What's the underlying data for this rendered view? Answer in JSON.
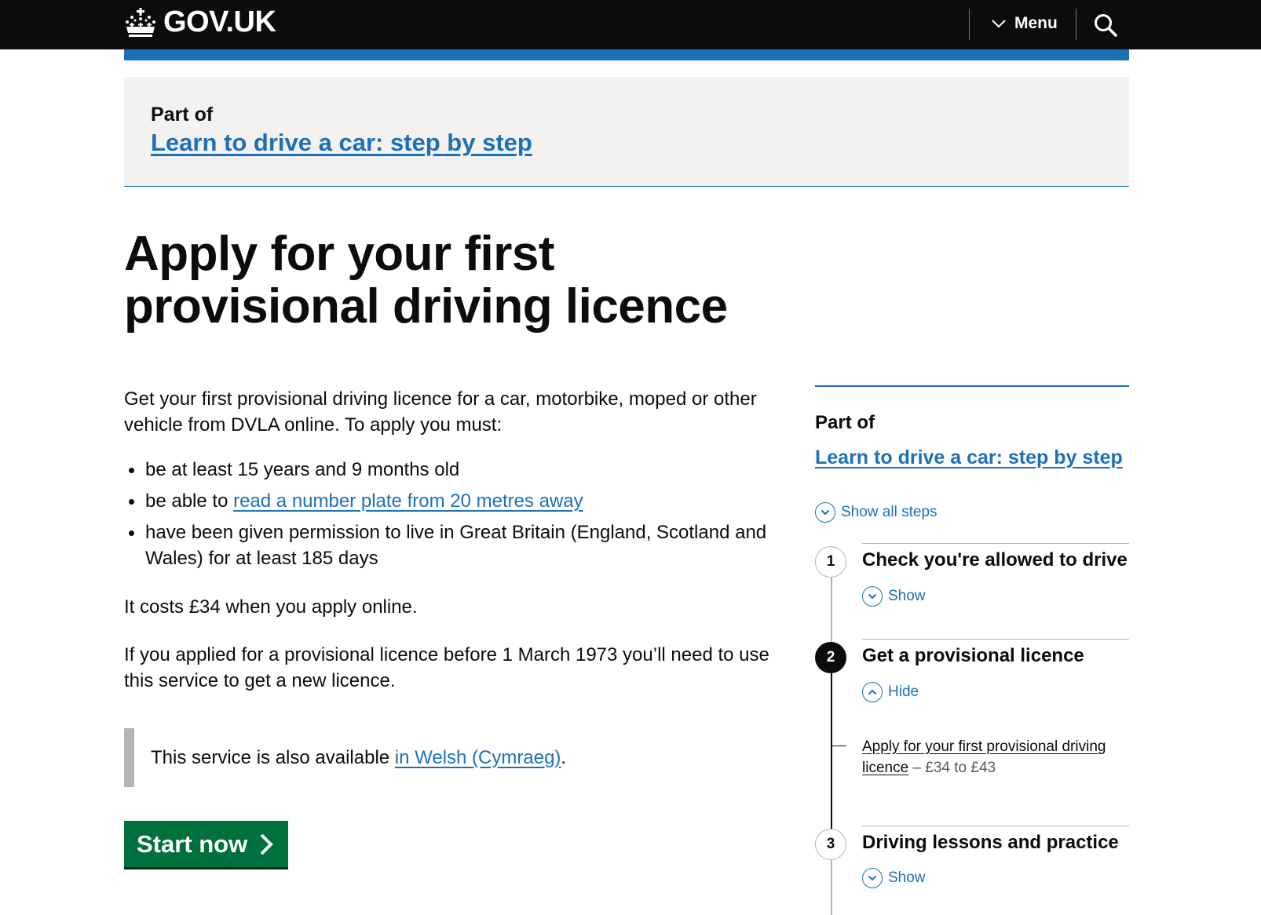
{
  "header": {
    "logo_text": "GOV.UK",
    "menu_label": "Menu",
    "search_icon": "search-icon"
  },
  "part_of_banner": {
    "label": "Part of",
    "link": "Learn to drive a car: step by step"
  },
  "page_title": "Apply for your first provisional driving licence",
  "intro": {
    "paragraph_1": "Get your first provisional driving licence for a car, motorbike, moped or other vehicle from DVLA online. To apply you must:",
    "requirements": [
      {
        "text": "be at least 15 years and 9 months old"
      },
      {
        "prefix": "be able to ",
        "link": "read a number plate from 20 metres away"
      },
      {
        "text": "have been given permission to live in Great Britain (England, Scotland and Wales) for at least 185 days"
      }
    ],
    "cost": "It costs £34 when you apply online.",
    "pre_1973": "If you applied for a provisional licence before 1 March 1973 you’ll need to use this service to get a new licence."
  },
  "inset": {
    "text": "This service is also available ",
    "link": "in Welsh (Cymraeg)",
    "suffix": "."
  },
  "start_button": {
    "label": "Start now",
    "icon": "chevron-right-icon"
  },
  "sidebar": {
    "label": "Part of",
    "link": "Learn to drive a car: step by step",
    "show_all": "Show all steps",
    "steps": [
      {
        "number": "1",
        "title": "Check you're allowed to drive",
        "toggle": "Show",
        "expanded": false
      },
      {
        "number": "2",
        "title": "Get a provisional licence",
        "toggle": "Hide",
        "expanded": true,
        "items": [
          {
            "link": "Apply for your first provisional driving licence",
            "price": " – £34 to £43"
          }
        ]
      },
      {
        "number": "3",
        "title": "Driving lessons and practice",
        "toggle": "Show",
        "expanded": false
      }
    ]
  },
  "colors": {
    "header_bg": "#0b0c0c",
    "brand_blue": "#1d70b8",
    "link": "#1d70b8",
    "start_green": "#00703c",
    "banner_bg": "#f3f2f1",
    "inset_border": "#b1b4b6"
  }
}
